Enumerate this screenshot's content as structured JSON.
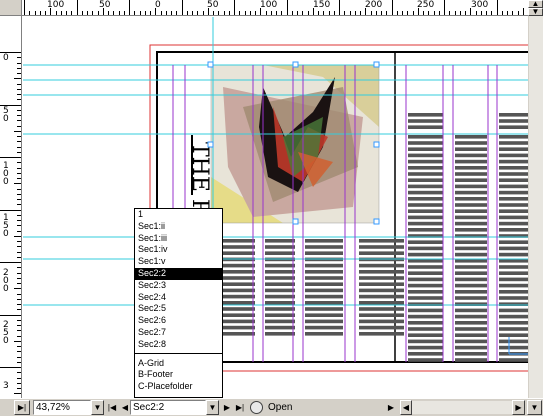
{
  "ruler": {
    "horizontal_labels": [
      "100",
      "50",
      "0",
      "50",
      "100",
      "150",
      "200",
      "250",
      "300"
    ],
    "vertical_labels": [
      "0",
      "5\n0",
      "1\n0\n0",
      "1\n5\n0",
      "2\n0\n0",
      "2\n5\n0",
      "3"
    ]
  },
  "document": {
    "masthead_text": "THE PAR"
  },
  "page_list": {
    "items": [
      {
        "label": "1",
        "selected": false
      },
      {
        "label": "Sec1:ii",
        "selected": false
      },
      {
        "label": "Sec1:iii",
        "selected": false
      },
      {
        "label": "Sec1:iv",
        "selected": false
      },
      {
        "label": "Sec1:v",
        "selected": false
      },
      {
        "label": "Sec2:2",
        "selected": true
      },
      {
        "label": "Sec2:3",
        "selected": false
      },
      {
        "label": "Sec2:4",
        "selected": false
      },
      {
        "label": "Sec2:5",
        "selected": false
      },
      {
        "label": "Sec2:6",
        "selected": false
      },
      {
        "label": "Sec2:7",
        "selected": false
      },
      {
        "label": "Sec2:8",
        "selected": false
      }
    ],
    "masters": [
      "A-Grid",
      "B-Footer",
      "C-Placefolder"
    ]
  },
  "statusbar": {
    "zoom_value": "43,72%",
    "page_value": "Sec2:2",
    "open_label": "Open"
  },
  "colors": {
    "chrome": "#d4d0c8",
    "guide_cyan": "#33ccdd",
    "column_purple": "#9933cc",
    "bleed_red": "#dd3333",
    "text_bar": "#555555"
  }
}
